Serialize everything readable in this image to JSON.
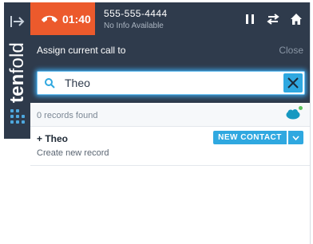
{
  "sidebar": {
    "brand_bold": "ten",
    "brand_light": "fold"
  },
  "call": {
    "timer": "01:40",
    "phone_number": "555-555-4444",
    "caller_info": "No Info Available"
  },
  "assign": {
    "label": "Assign current call to",
    "close_label": "Close"
  },
  "search": {
    "value": "Theo"
  },
  "records": {
    "count_label": "0 records found"
  },
  "result": {
    "name": "+ Theo",
    "subtitle": "Create new record",
    "new_contact_label": "NEW CONTACT"
  },
  "colors": {
    "dark": "#2f3b4c",
    "timer_bg": "#ec5a2c",
    "accent": "#2fa8e0"
  }
}
